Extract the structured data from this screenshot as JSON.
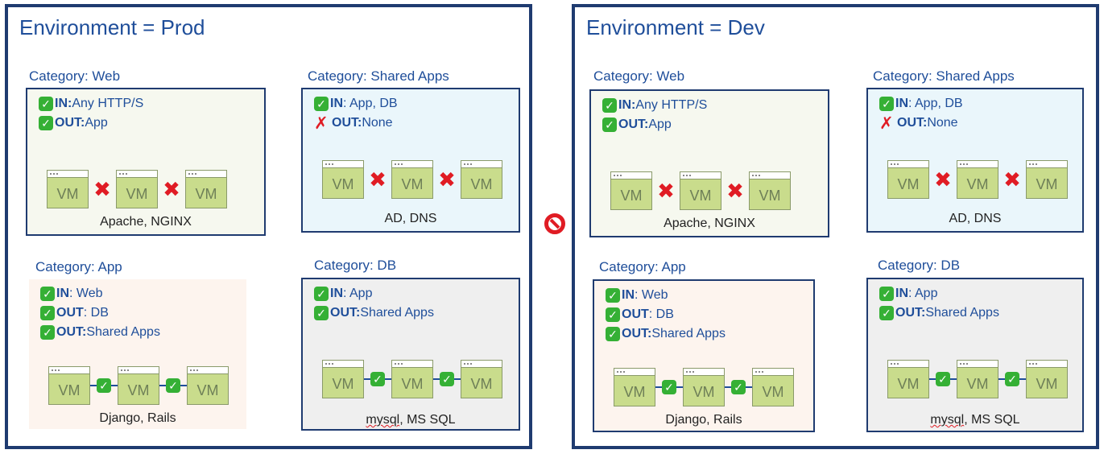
{
  "environments": [
    {
      "title": "Environment = Prod",
      "categories": {
        "web": {
          "title": "Category: Web",
          "rules": [
            {
              "kw": "IN:",
              "text": " Any HTTP/S"
            },
            {
              "kw": "OUT:",
              "text": " App"
            }
          ],
          "vm_label": "VM",
          "caption": "Apache, NGINX"
        },
        "shared": {
          "title": "Category: Shared Apps",
          "rules": [
            {
              "kw": "IN",
              "text": ": App, DB"
            },
            {
              "kw": "OUT:",
              "text": " None"
            }
          ],
          "vm_label": "VM",
          "caption": "AD, DNS"
        },
        "app": {
          "title": "Category: App",
          "rules": [
            {
              "kw": "IN",
              "text": ": Web"
            },
            {
              "kw": "OUT",
              "text": ": DB"
            },
            {
              "kw": "OUT:",
              "text": " Shared Apps"
            }
          ],
          "vm_label": "VM",
          "caption": "Django, Rails"
        },
        "db": {
          "title": "Category: DB",
          "rules": [
            {
              "kw": "IN",
              "text": ": App"
            },
            {
              "kw": "OUT:",
              "text": " Shared Apps"
            }
          ],
          "vm_label": "VM",
          "caption_a": "mysql",
          "caption_b": ", MS SQL"
        }
      }
    },
    {
      "title": "Environment = Dev",
      "categories": {
        "web": {
          "title": "Category: Web",
          "rules": [
            {
              "kw": "IN:",
              "text": " Any HTTP/S"
            },
            {
              "kw": "OUT:",
              "text": " App"
            }
          ],
          "vm_label": "VM",
          "caption": "Apache, NGINX"
        },
        "shared": {
          "title": "Category: Shared Apps",
          "rules": [
            {
              "kw": "IN",
              "text": ": App, DB"
            },
            {
              "kw": "OUT:",
              "text": " None"
            }
          ],
          "vm_label": "VM",
          "caption": "AD, DNS"
        },
        "app": {
          "title": "Category: App",
          "rules": [
            {
              "kw": "IN",
              "text": ": Web"
            },
            {
              "kw": "OUT",
              "text": ": DB"
            },
            {
              "kw": "OUT:",
              "text": " Shared Apps"
            }
          ],
          "vm_label": "VM",
          "caption": "Django, Rails"
        },
        "db": {
          "title": "Category: DB",
          "rules": [
            {
              "kw": "IN",
              "text": ": App"
            },
            {
              "kw": "OUT:",
              "text": " Shared Apps"
            }
          ],
          "vm_label": "VM",
          "caption_a": "mysql",
          "caption_b": ", MS SQL"
        }
      }
    }
  ],
  "icons": {
    "allowed": "check-icon",
    "denied": "cross-icon",
    "separator": "no-entry-icon"
  },
  "colors": {
    "border": "#1f3b70",
    "title": "#1f4e9a",
    "allow": "#35b035",
    "deny": "#e01c24",
    "vm": "#c9dc8c"
  }
}
